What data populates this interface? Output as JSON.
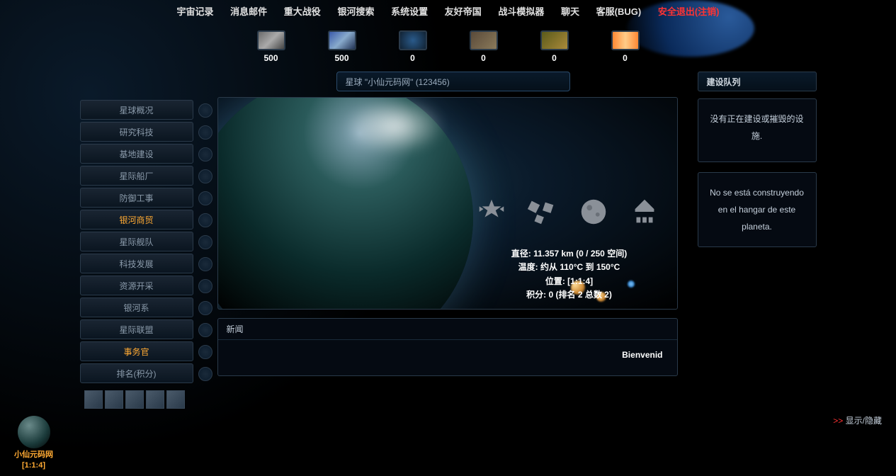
{
  "topnav": {
    "items": [
      "宇宙记录",
      "消息邮件",
      "重大战役",
      "银河搜索",
      "系统设置",
      "友好帝国",
      "战斗模拟器",
      "聊天",
      "客服(BUG)"
    ],
    "logout": "安全退出(注销)"
  },
  "resources": [
    {
      "name": "metal",
      "value": "500"
    },
    {
      "name": "crystal",
      "value": "500"
    },
    {
      "name": "deuterium",
      "value": "0"
    },
    {
      "name": "norio",
      "value": "0"
    },
    {
      "name": "darkmatter",
      "value": "0"
    },
    {
      "name": "energy",
      "value": "0"
    }
  ],
  "planet_title": "星球 \"小仙元码网\" (123456)",
  "menu": [
    {
      "label": "星球概况",
      "active": false
    },
    {
      "label": "研究科技",
      "active": false
    },
    {
      "label": "基地建设",
      "active": false
    },
    {
      "label": "星际船厂",
      "active": false
    },
    {
      "label": "防御工事",
      "active": false
    },
    {
      "label": "银河商贸",
      "active": true
    },
    {
      "label": "星际舰队",
      "active": false
    },
    {
      "label": "科技发展",
      "active": false
    },
    {
      "label": "资源开采",
      "active": false
    },
    {
      "label": "银河系",
      "active": false
    },
    {
      "label": "星际联盟",
      "active": false
    },
    {
      "label": "事务官",
      "active": true
    },
    {
      "label": "排名(积分)",
      "active": false
    }
  ],
  "stats": {
    "diameter": "直径: 11.357 km (0 / 250 空间)",
    "temp": "温度: 约从 110°C 到 150°C",
    "position": "位置: [1:1:4]",
    "points": "积分: 0 (排名 2 总数 2)"
  },
  "news": {
    "header": "新闻",
    "marquee": "Bienvenid"
  },
  "queue": {
    "header": "建设队列",
    "building_msg": "没有正在建设或摧毁的设施.",
    "hangar_msg": "No se está construyendo en el hangar de este planeta."
  },
  "toggle": {
    "arrows": ">>",
    "label": "显示/隐藏"
  },
  "footer_planet": {
    "name": "小仙元码网",
    "coords": "[1:1:4]"
  }
}
